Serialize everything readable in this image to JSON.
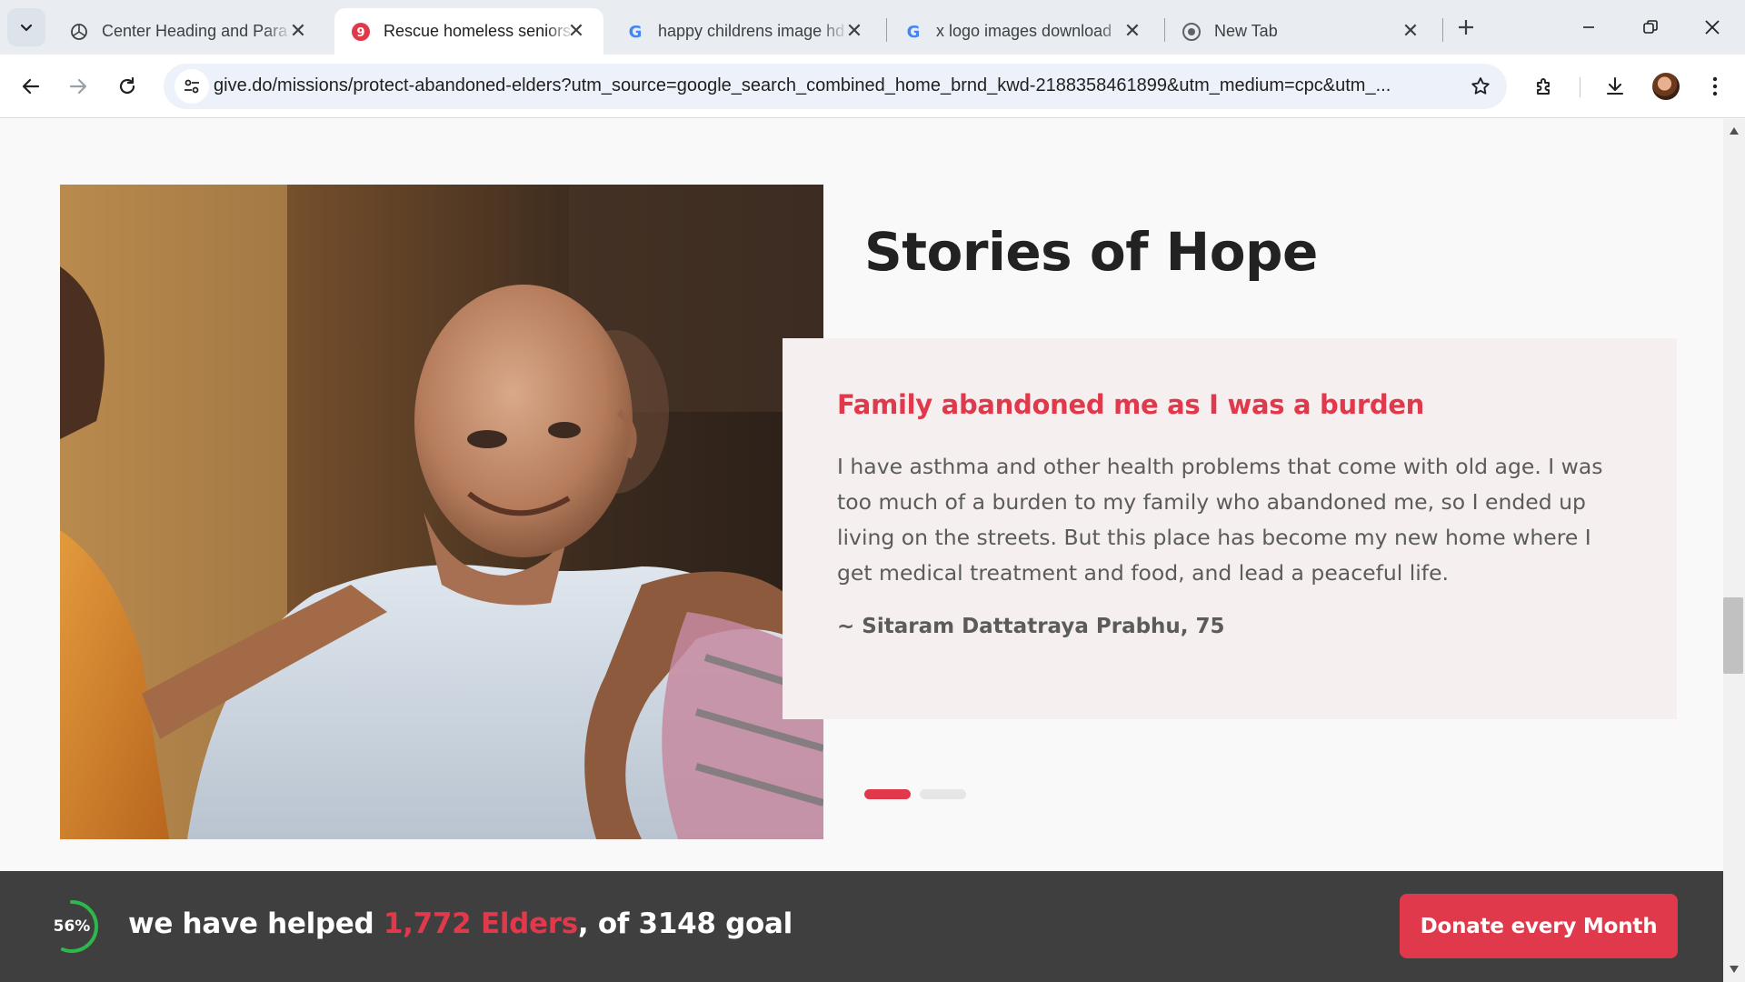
{
  "browser": {
    "tabs": [
      {
        "title": "Center Heading and Para",
        "icon": "openai-icon",
        "active": false
      },
      {
        "title": "Rescue homeless seniors",
        "icon": "give-icon",
        "active": true
      },
      {
        "title": "happy childrens image hd",
        "icon": "google-icon",
        "active": false
      },
      {
        "title": "x logo images download",
        "icon": "google-icon",
        "active": false
      },
      {
        "title": "New Tab",
        "icon": "chrome-icon",
        "active": false
      }
    ],
    "url": "give.do/missions/protect-abandoned-elders?utm_source=google_search_combined_home_brnd_kwd-2188358461899&utm_medium=cpc&utm_...",
    "close_glyph": "✕"
  },
  "section": {
    "title": "Stories of Hope"
  },
  "story": {
    "heading": "Family abandoned me as I was a burden",
    "body": "I have asthma and other health problems that come with old age. I was too much of a burden to my family who abandoned me, so I ended up living on the streets. But this place has become my new home where I get medical treatment and food, and lead a peaceful life.",
    "author": "~ Sitaram Dattatraya Prabhu, 75"
  },
  "carousel": {
    "slide_count": 2,
    "active_index": 0
  },
  "footer": {
    "progress_label": "56%",
    "progress_value": 0.56,
    "text_prefix": "we have helped ",
    "highlight": "1,772 Elders",
    "text_suffix": ", of 3148 goal",
    "donate_label": "Donate every Month"
  },
  "colors": {
    "accent": "#e0394b",
    "footer_bg": "#3f3f3f",
    "card_bg": "#f5efef",
    "progress": "#2db84c"
  }
}
